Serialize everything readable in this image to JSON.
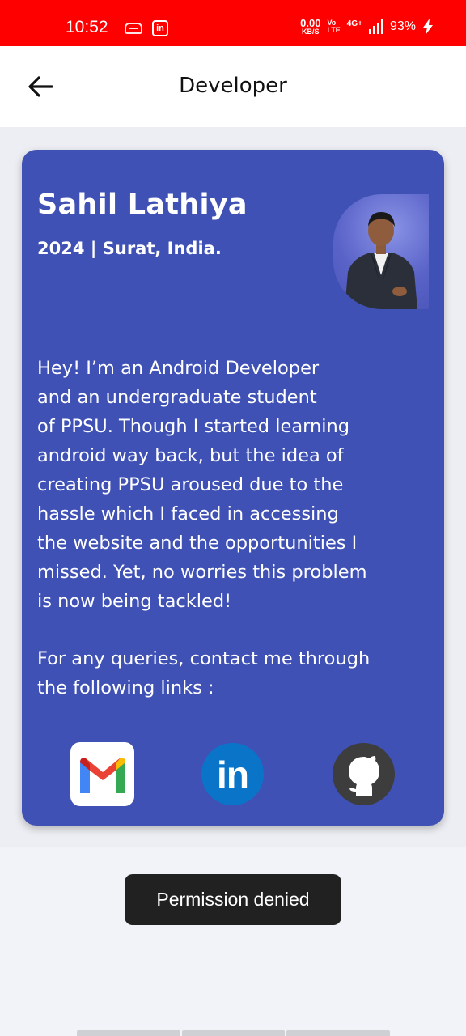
{
  "status_bar": {
    "time": "10:52",
    "net_speed_value": "0.00",
    "net_speed_unit": "KB/S",
    "volte_top": "Vo",
    "volte_bottom": "LTE",
    "network_type": "4G+",
    "battery": "93%",
    "color": "#ff0000",
    "icons": [
      "car-icon",
      "linkedin-notification-icon",
      "signal-icon",
      "charging-bolt-icon"
    ]
  },
  "app_bar": {
    "title": "Developer",
    "back_icon": "arrow-left-icon"
  },
  "card": {
    "name": "Sahil Lathiya",
    "meta": "2024 | Surat, India.",
    "bio": "Hey! I’m an Android Developer\nand an undergraduate student\nof PPSU. Though I started learning\nandroid way back, but the idea of\ncreating PPSU aroused due to the\nhassle which I faced in accessing\nthe website and the opportunities I\nmissed. Yet, no worries this problem\nis now being tackled!",
    "contact": "For any queries, contact me through\nthe following links :",
    "background": "#3f51b5",
    "links": [
      {
        "icon": "gmail-icon"
      },
      {
        "icon": "linkedin-icon",
        "text": "in"
      },
      {
        "icon": "github-icon"
      }
    ]
  },
  "toast": {
    "message": "Permission denied"
  }
}
